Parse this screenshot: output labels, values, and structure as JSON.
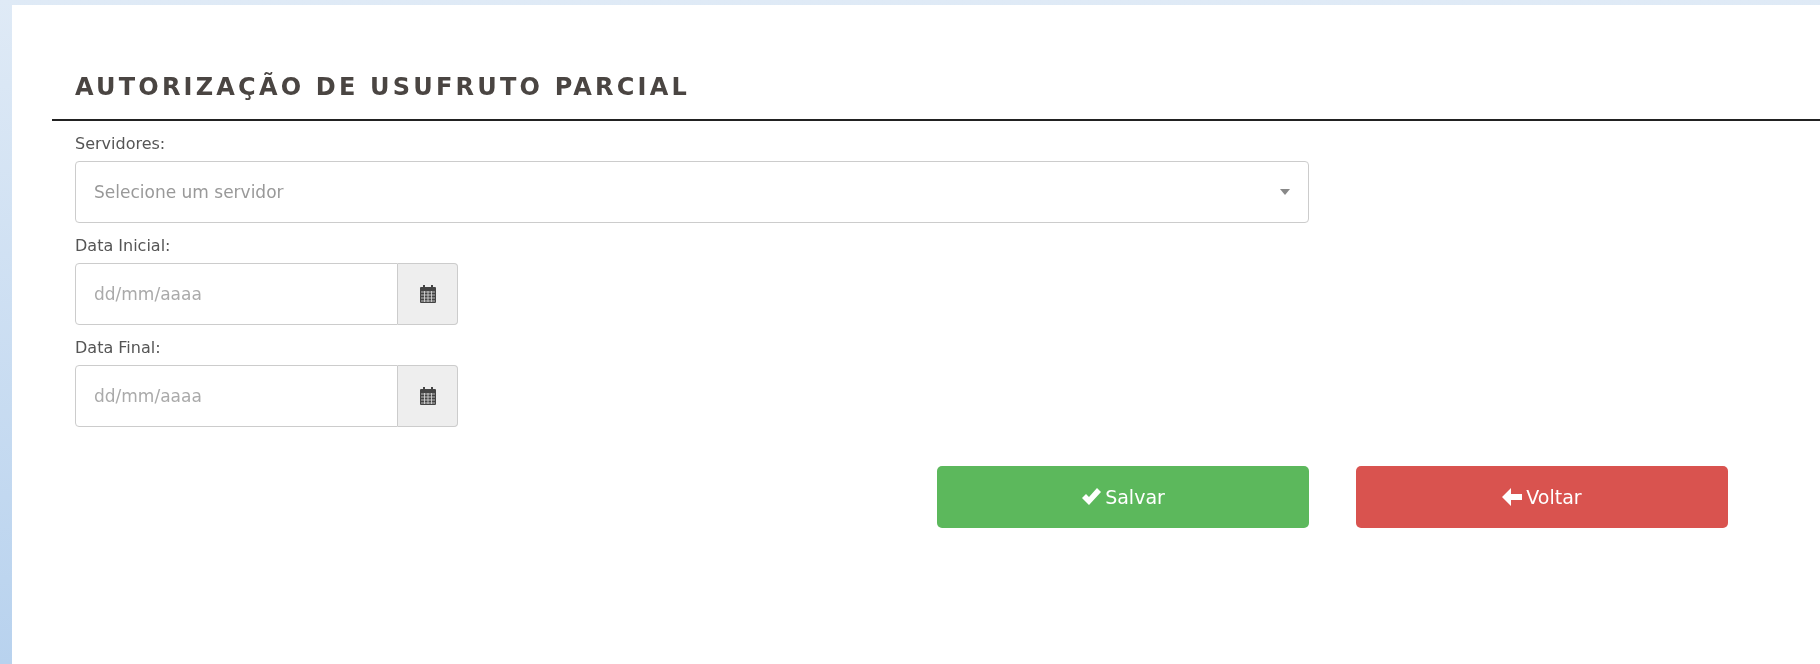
{
  "title": "AUTORIZAÇÃO DE USUFRUTO PARCIAL",
  "fields": [
    {
      "kind": "select",
      "label": "Servidores:",
      "placeholder": "Selecione um servidor"
    },
    {
      "kind": "date",
      "label": "Data Inicial:",
      "placeholder": "dd/mm/aaaa"
    },
    {
      "kind": "date",
      "label": "Data Final:",
      "placeholder": "dd/mm/aaaa"
    }
  ],
  "buttons": [
    {
      "kind": "save",
      "label": "Salvar"
    },
    {
      "kind": "back",
      "label": "Voltar"
    }
  ]
}
